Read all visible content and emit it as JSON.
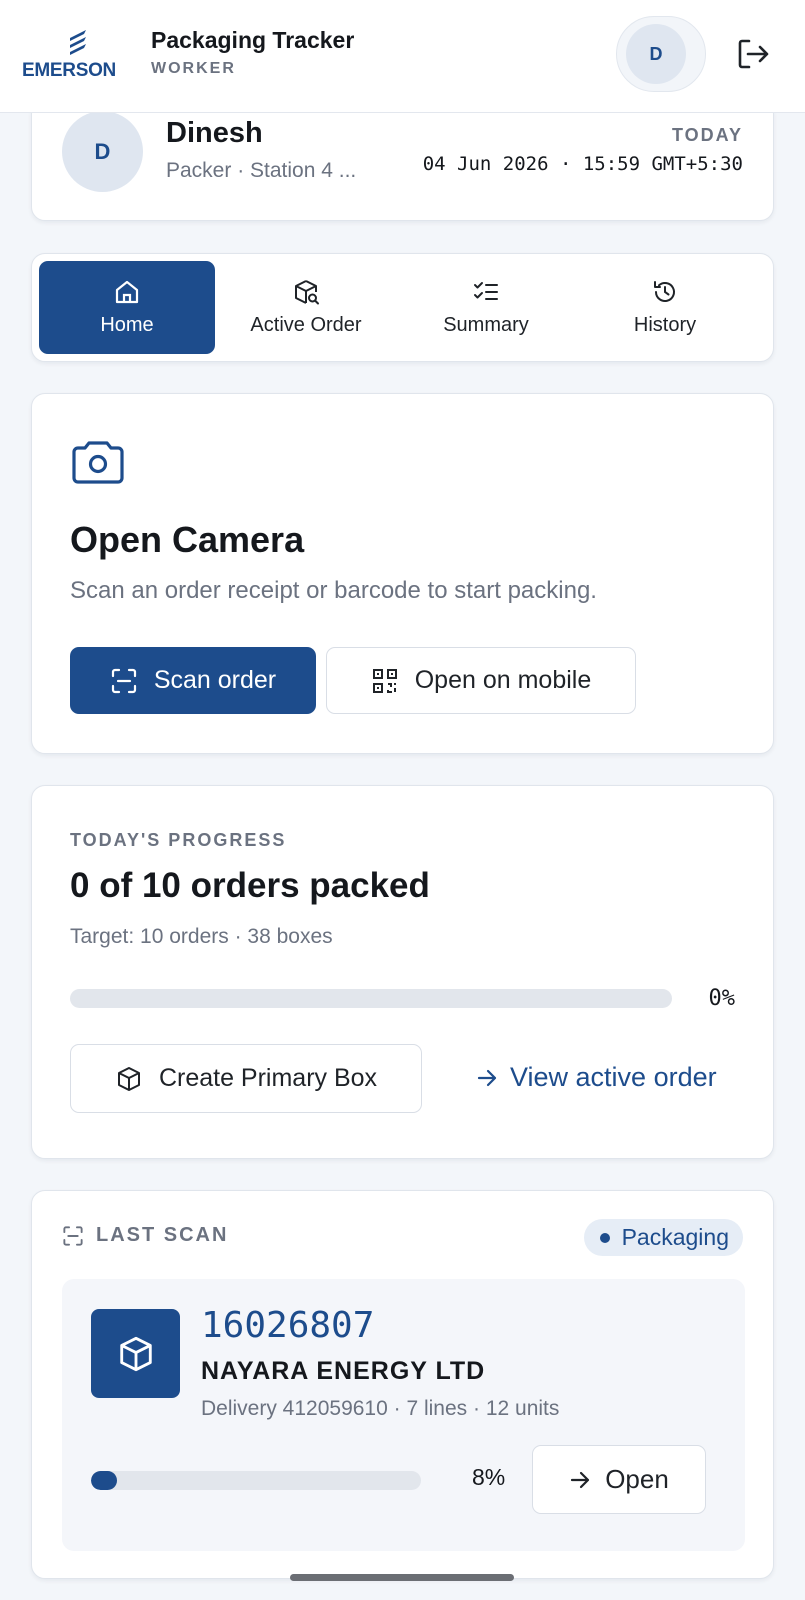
{
  "header": {
    "logo_text": "EMERSON",
    "app_title": "Packaging Tracker",
    "role": "WORKER",
    "avatar_initial": "D"
  },
  "profile": {
    "avatar_initial": "D",
    "name": "Dinesh",
    "role_station": "Packer · Station 4 ...",
    "today_label": "TODAY",
    "datetime": "04 Jun 2026 · 15:59 GMT+5:30"
  },
  "tabs": [
    {
      "label": "Home",
      "icon": "home-icon",
      "active": true
    },
    {
      "label": "Active Order",
      "icon": "box-search-icon",
      "active": false
    },
    {
      "label": "Summary",
      "icon": "checklist-icon",
      "active": false
    },
    {
      "label": "History",
      "icon": "history-icon",
      "active": false
    }
  ],
  "camera": {
    "icon": "camera-icon",
    "title": "Open Camera",
    "subtitle": "Scan an order receipt or barcode to start packing.",
    "scan_button": "Scan order",
    "mobile_button": "Open on mobile"
  },
  "progress": {
    "label": "TODAY'S PROGRESS",
    "title": "0 of 10 orders packed",
    "target": "Target: 10 orders · 38 boxes",
    "percent_text": "0%",
    "percent_value": 0,
    "create_box_button": "Create Primary Box",
    "view_active_link": "View active order"
  },
  "last_scan": {
    "label": "LAST SCAN",
    "status": "Packaging",
    "order_number": "16026807",
    "company": "NAYARA ENERGY LTD",
    "meta": "Delivery 412059610 · 7 lines · 12 units",
    "percent_text": "8%",
    "percent_value": 8,
    "open_button": "Open"
  },
  "colors": {
    "primary": "#1d4c8c",
    "background": "#f3f6fa",
    "muted_text": "#6b7280"
  }
}
